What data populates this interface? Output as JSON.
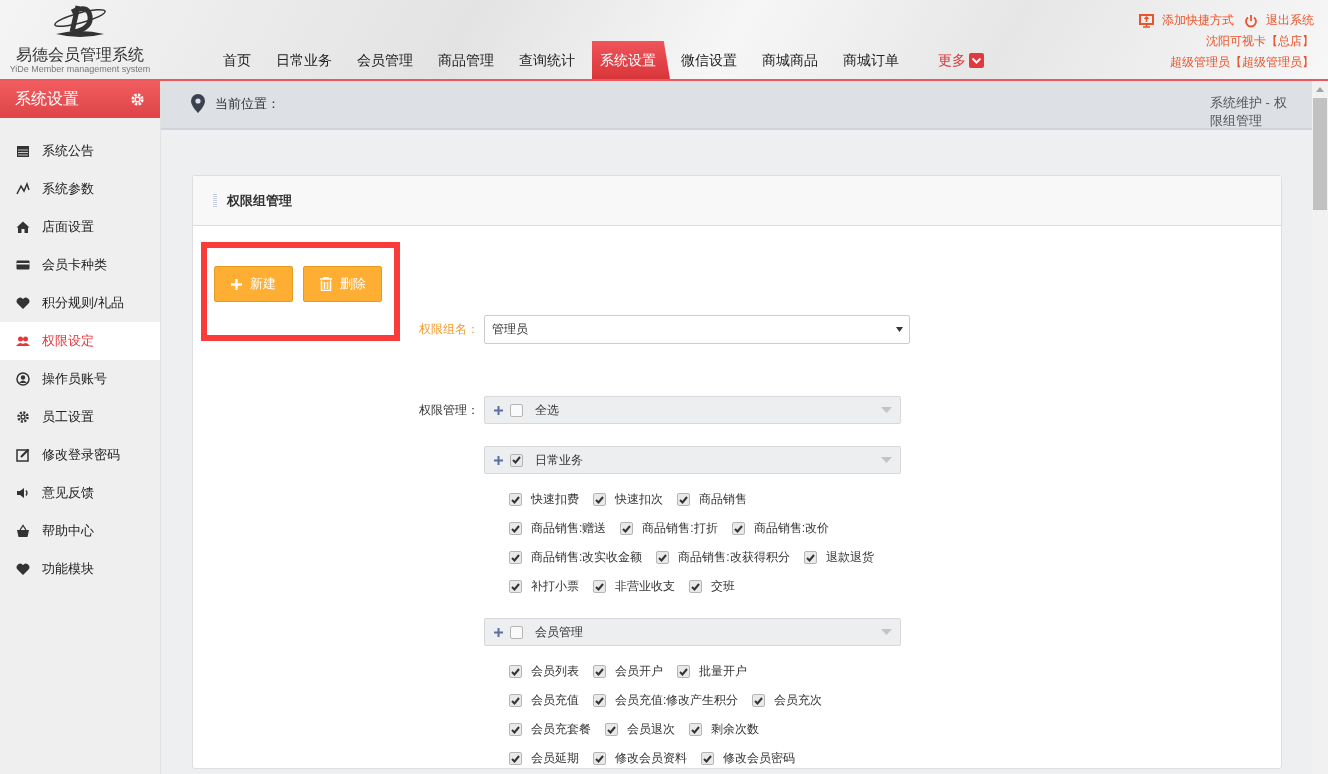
{
  "header": {
    "logo_title": "易德会员管理系统",
    "logo_subtitle": "YiDe Member management system",
    "nav": [
      {
        "label": "首页",
        "selected": false
      },
      {
        "label": "日常业务",
        "selected": false
      },
      {
        "label": "会员管理",
        "selected": false
      },
      {
        "label": "商品管理",
        "selected": false
      },
      {
        "label": "查询统计",
        "selected": false
      },
      {
        "label": "系统设置",
        "selected": true
      },
      {
        "label": "微信设置",
        "selected": false
      },
      {
        "label": "商城商品",
        "selected": false
      },
      {
        "label": "商城订单",
        "selected": false
      }
    ],
    "more": "更多",
    "top_links": [
      {
        "label": "添加快捷方式",
        "kind": "shortcut"
      },
      {
        "label": "退出系统",
        "kind": "logout"
      }
    ],
    "store": "沈阳可视卡【总店】",
    "user": "超级管理员【超级管理员】"
  },
  "sidebar": {
    "title": "系统设置",
    "items": [
      {
        "label": "系统公告",
        "selected": false
      },
      {
        "label": "系统参数",
        "selected": false
      },
      {
        "label": "店面设置",
        "selected": false
      },
      {
        "label": "会员卡种类",
        "selected": false
      },
      {
        "label": "积分规则/礼品",
        "selected": false
      },
      {
        "label": "权限设定",
        "selected": true
      },
      {
        "label": "操作员账号",
        "selected": false
      },
      {
        "label": "员工设置",
        "selected": false
      },
      {
        "label": "修改登录密码",
        "selected": false
      },
      {
        "label": "意见反馈",
        "selected": false
      },
      {
        "label": "帮助中心",
        "selected": false
      },
      {
        "label": "功能模块",
        "selected": false
      }
    ]
  },
  "breadcrumb": {
    "label": "当前位置：",
    "path": "系统维护 - 权限组管理"
  },
  "panel": {
    "title": "权限组管理",
    "buttons_highlighted": true,
    "buttons": [
      {
        "label": "新建",
        "kind": "add"
      },
      {
        "label": "删除",
        "kind": "delete"
      }
    ],
    "group_name_label": "权限组名：",
    "group_name_value": "管理员",
    "permission_label": "权限管理：",
    "groups": [
      {
        "label": "全选",
        "checked": false
      },
      {
        "label": "日常业务",
        "checked": true,
        "rows": [
          [
            {
              "label": "快速扣费",
              "checked": true
            },
            {
              "label": "快速扣次",
              "checked": true
            },
            {
              "label": "商品销售",
              "checked": true
            }
          ],
          [
            {
              "label": "商品销售:赠送",
              "checked": true
            },
            {
              "label": "商品销售:打折",
              "checked": true
            },
            {
              "label": "商品销售:改价",
              "checked": true
            }
          ],
          [
            {
              "label": "商品销售:改实收金额",
              "checked": true
            },
            {
              "label": "商品销售:改获得积分",
              "checked": true
            },
            {
              "label": "退款退货",
              "checked": true
            }
          ],
          [
            {
              "label": "补打小票",
              "checked": true
            },
            {
              "label": "非营业收支",
              "checked": true
            },
            {
              "label": "交班",
              "checked": true
            }
          ]
        ]
      },
      {
        "label": "会员管理",
        "checked": false,
        "rows": [
          [
            {
              "label": "会员列表",
              "checked": true
            },
            {
              "label": "会员开户",
              "checked": true
            },
            {
              "label": "批量开户",
              "checked": true
            }
          ],
          [
            {
              "label": "会员充值",
              "checked": true
            },
            {
              "label": "会员充值:修改产生积分",
              "checked": true
            },
            {
              "label": "会员充次",
              "checked": true
            }
          ],
          [
            {
              "label": "会员充套餐",
              "checked": true
            },
            {
              "label": "会员退次",
              "checked": true
            },
            {
              "label": "剩余次数",
              "checked": true
            }
          ],
          [
            {
              "label": "会员延期",
              "checked": true
            },
            {
              "label": "修改会员资料",
              "checked": true
            },
            {
              "label": "修改会员密码",
              "checked": true
            }
          ]
        ]
      }
    ]
  }
}
